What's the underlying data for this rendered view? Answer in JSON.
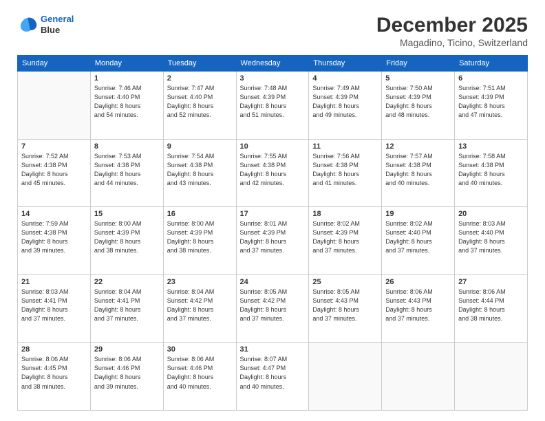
{
  "logo": {
    "line1": "General",
    "line2": "Blue"
  },
  "title": "December 2025",
  "subtitle": "Magadino, Ticino, Switzerland",
  "weekdays": [
    "Sunday",
    "Monday",
    "Tuesday",
    "Wednesday",
    "Thursday",
    "Friday",
    "Saturday"
  ],
  "weeks": [
    [
      {
        "day": "",
        "info": ""
      },
      {
        "day": "1",
        "info": "Sunrise: 7:46 AM\nSunset: 4:40 PM\nDaylight: 8 hours\nand 54 minutes."
      },
      {
        "day": "2",
        "info": "Sunrise: 7:47 AM\nSunset: 4:40 PM\nDaylight: 8 hours\nand 52 minutes."
      },
      {
        "day": "3",
        "info": "Sunrise: 7:48 AM\nSunset: 4:39 PM\nDaylight: 8 hours\nand 51 minutes."
      },
      {
        "day": "4",
        "info": "Sunrise: 7:49 AM\nSunset: 4:39 PM\nDaylight: 8 hours\nand 49 minutes."
      },
      {
        "day": "5",
        "info": "Sunrise: 7:50 AM\nSunset: 4:39 PM\nDaylight: 8 hours\nand 48 minutes."
      },
      {
        "day": "6",
        "info": "Sunrise: 7:51 AM\nSunset: 4:39 PM\nDaylight: 8 hours\nand 47 minutes."
      }
    ],
    [
      {
        "day": "7",
        "info": "Sunrise: 7:52 AM\nSunset: 4:38 PM\nDaylight: 8 hours\nand 45 minutes."
      },
      {
        "day": "8",
        "info": "Sunrise: 7:53 AM\nSunset: 4:38 PM\nDaylight: 8 hours\nand 44 minutes."
      },
      {
        "day": "9",
        "info": "Sunrise: 7:54 AM\nSunset: 4:38 PM\nDaylight: 8 hours\nand 43 minutes."
      },
      {
        "day": "10",
        "info": "Sunrise: 7:55 AM\nSunset: 4:38 PM\nDaylight: 8 hours\nand 42 minutes."
      },
      {
        "day": "11",
        "info": "Sunrise: 7:56 AM\nSunset: 4:38 PM\nDaylight: 8 hours\nand 41 minutes."
      },
      {
        "day": "12",
        "info": "Sunrise: 7:57 AM\nSunset: 4:38 PM\nDaylight: 8 hours\nand 40 minutes."
      },
      {
        "day": "13",
        "info": "Sunrise: 7:58 AM\nSunset: 4:38 PM\nDaylight: 8 hours\nand 40 minutes."
      }
    ],
    [
      {
        "day": "14",
        "info": "Sunrise: 7:59 AM\nSunset: 4:38 PM\nDaylight: 8 hours\nand 39 minutes."
      },
      {
        "day": "15",
        "info": "Sunrise: 8:00 AM\nSunset: 4:39 PM\nDaylight: 8 hours\nand 38 minutes."
      },
      {
        "day": "16",
        "info": "Sunrise: 8:00 AM\nSunset: 4:39 PM\nDaylight: 8 hours\nand 38 minutes."
      },
      {
        "day": "17",
        "info": "Sunrise: 8:01 AM\nSunset: 4:39 PM\nDaylight: 8 hours\nand 37 minutes."
      },
      {
        "day": "18",
        "info": "Sunrise: 8:02 AM\nSunset: 4:39 PM\nDaylight: 8 hours\nand 37 minutes."
      },
      {
        "day": "19",
        "info": "Sunrise: 8:02 AM\nSunset: 4:40 PM\nDaylight: 8 hours\nand 37 minutes."
      },
      {
        "day": "20",
        "info": "Sunrise: 8:03 AM\nSunset: 4:40 PM\nDaylight: 8 hours\nand 37 minutes."
      }
    ],
    [
      {
        "day": "21",
        "info": "Sunrise: 8:03 AM\nSunset: 4:41 PM\nDaylight: 8 hours\nand 37 minutes."
      },
      {
        "day": "22",
        "info": "Sunrise: 8:04 AM\nSunset: 4:41 PM\nDaylight: 8 hours\nand 37 minutes."
      },
      {
        "day": "23",
        "info": "Sunrise: 8:04 AM\nSunset: 4:42 PM\nDaylight: 8 hours\nand 37 minutes."
      },
      {
        "day": "24",
        "info": "Sunrise: 8:05 AM\nSunset: 4:42 PM\nDaylight: 8 hours\nand 37 minutes."
      },
      {
        "day": "25",
        "info": "Sunrise: 8:05 AM\nSunset: 4:43 PM\nDaylight: 8 hours\nand 37 minutes."
      },
      {
        "day": "26",
        "info": "Sunrise: 8:06 AM\nSunset: 4:43 PM\nDaylight: 8 hours\nand 37 minutes."
      },
      {
        "day": "27",
        "info": "Sunrise: 8:06 AM\nSunset: 4:44 PM\nDaylight: 8 hours\nand 38 minutes."
      }
    ],
    [
      {
        "day": "28",
        "info": "Sunrise: 8:06 AM\nSunset: 4:45 PM\nDaylight: 8 hours\nand 38 minutes."
      },
      {
        "day": "29",
        "info": "Sunrise: 8:06 AM\nSunset: 4:46 PM\nDaylight: 8 hours\nand 39 minutes."
      },
      {
        "day": "30",
        "info": "Sunrise: 8:06 AM\nSunset: 4:46 PM\nDaylight: 8 hours\nand 40 minutes."
      },
      {
        "day": "31",
        "info": "Sunrise: 8:07 AM\nSunset: 4:47 PM\nDaylight: 8 hours\nand 40 minutes."
      },
      {
        "day": "",
        "info": ""
      },
      {
        "day": "",
        "info": ""
      },
      {
        "day": "",
        "info": ""
      }
    ]
  ]
}
